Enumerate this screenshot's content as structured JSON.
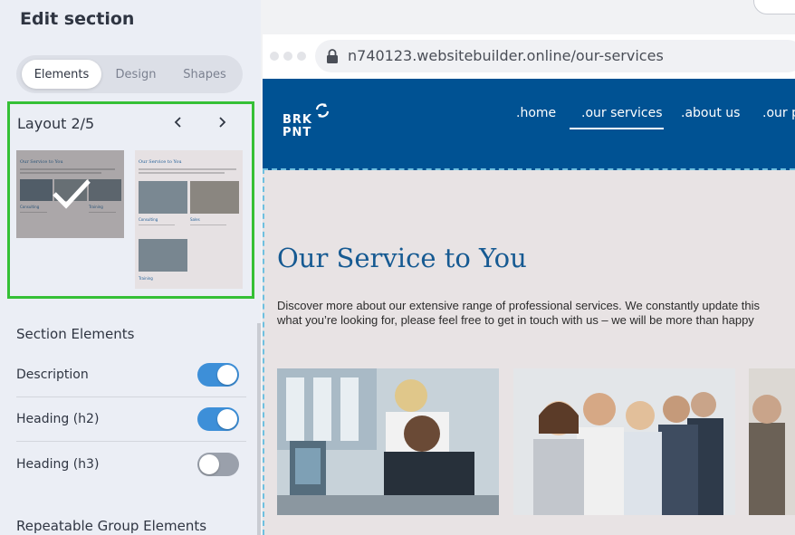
{
  "panel": {
    "title": "Edit section",
    "tabs": [
      "Elements",
      "Design",
      "Shapes"
    ],
    "active_tab": "Elements",
    "layout": {
      "label": "Layout 2/5"
    },
    "thumb": {
      "title": "Our Service to You",
      "cap1": "Consulting",
      "cap2": "Sales",
      "cap3": "Training"
    },
    "section_elements": {
      "heading": "Section Elements",
      "items": [
        {
          "label": "Description",
          "state": "on"
        },
        {
          "label": "Heading (h2)",
          "state": "on"
        },
        {
          "label": "Heading (h3)",
          "state": "off"
        }
      ]
    },
    "repeatable_heading": "Repeatable Group Elements"
  },
  "browser": {
    "url": "n740123.websitebuilder.online/our-services"
  },
  "site": {
    "logo": {
      "line1": "BRK",
      "line2": "PNT"
    },
    "nav": [
      ".home",
      ".our services",
      ".about us",
      ".our p"
    ],
    "heading": "Our Service to You",
    "description_line1": "Discover more about our extensive range of professional services. We constantly update this",
    "description_line2": "what you’re looking for, please feel free to get in touch with us – we will be more than happy"
  },
  "colors": {
    "accent_blue": "#3d8fd8",
    "site_header": "#005293",
    "selection_green": "#35c036",
    "heading_blue": "#165a92"
  }
}
